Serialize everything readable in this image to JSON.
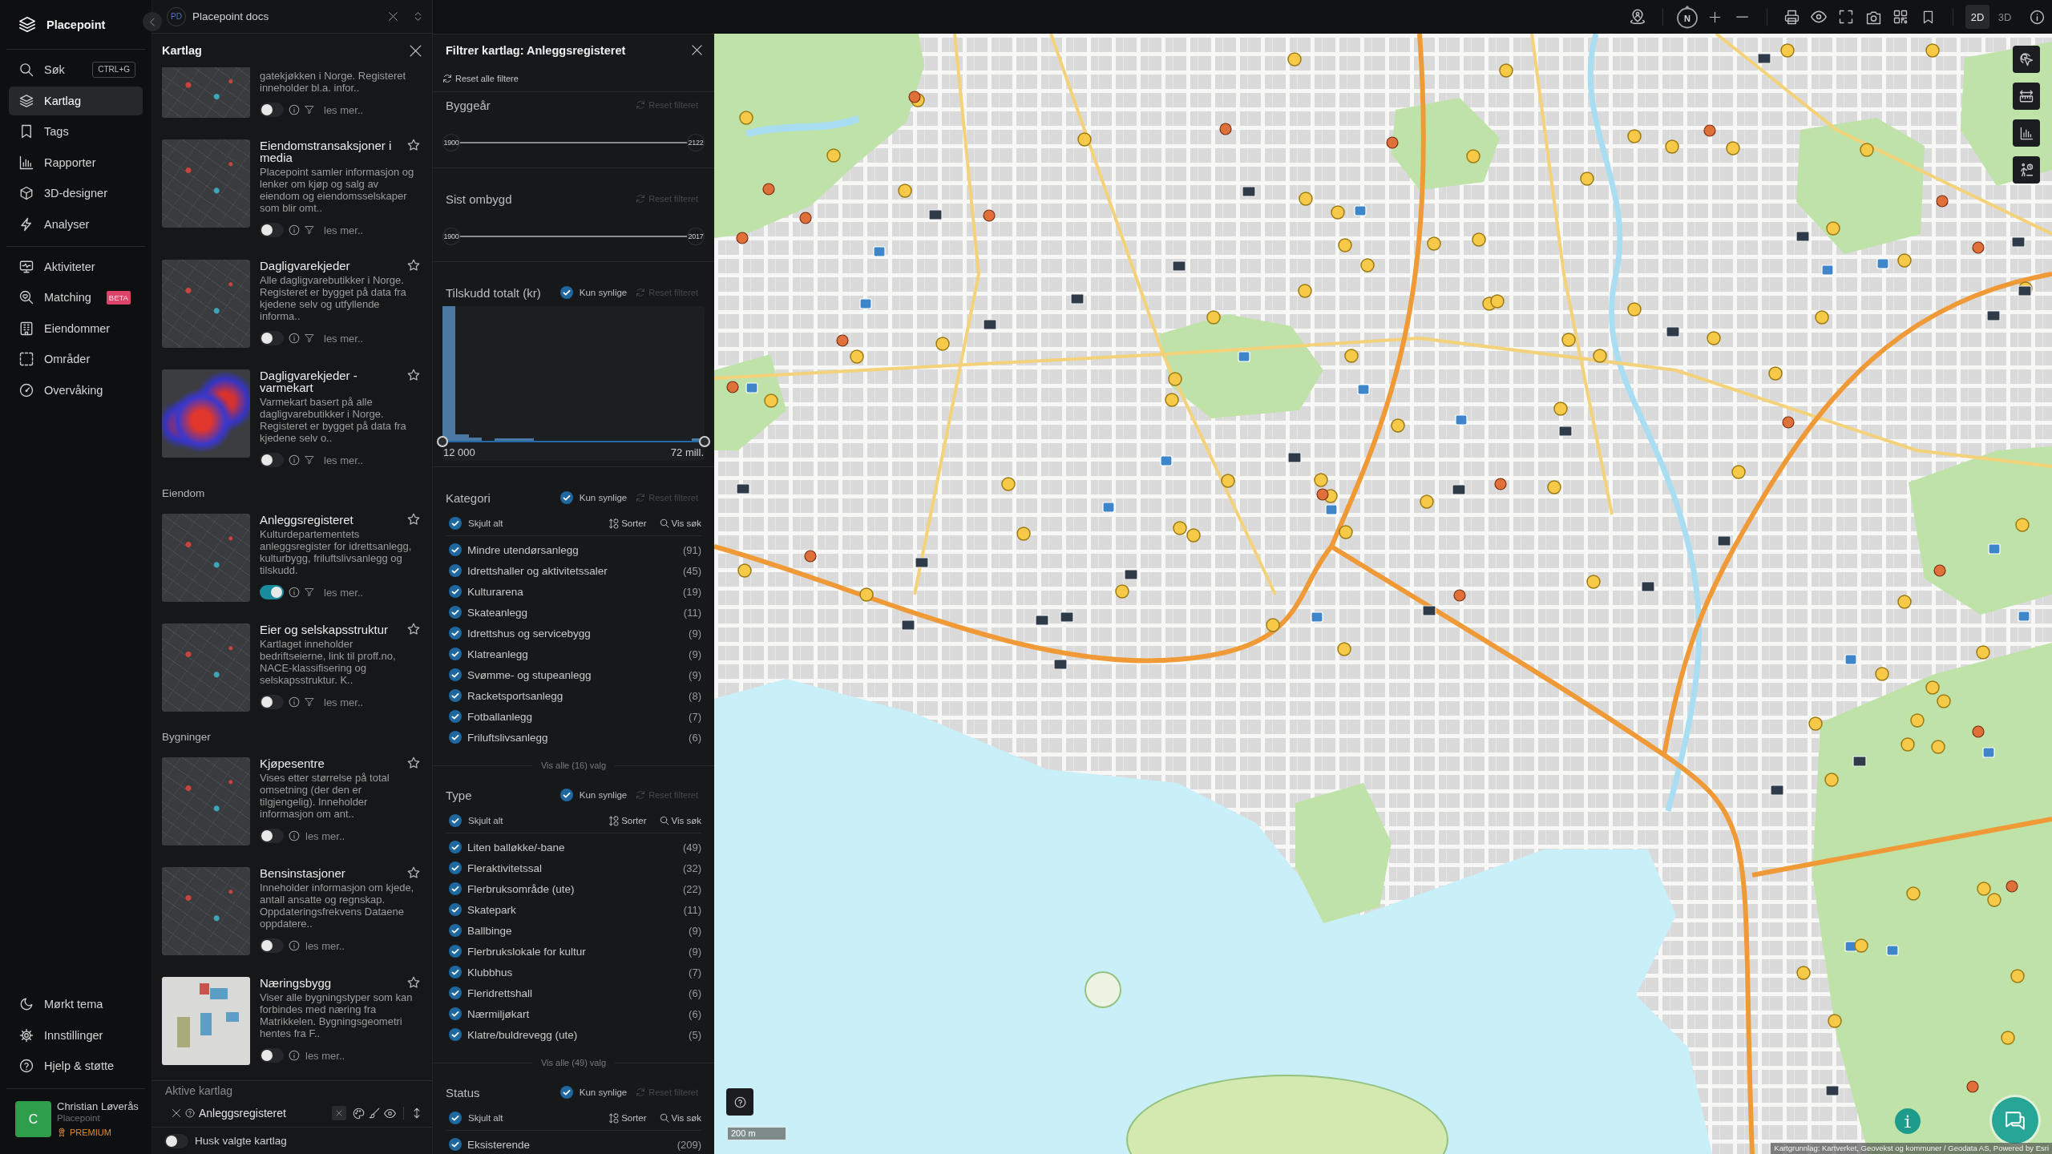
{
  "app": {
    "name": "Placepoint"
  },
  "nav": {
    "main": [
      {
        "label": "Søk",
        "shortcut": "CTRL+G",
        "selected": false
      },
      {
        "label": "Kartlag",
        "selected": true
      },
      {
        "label": "Tags",
        "selected": false
      },
      {
        "label": "Rapporter",
        "selected": false
      },
      {
        "label": "3D-designer",
        "selected": false
      },
      {
        "label": "Analyser",
        "selected": false
      }
    ],
    "secondary": [
      {
        "label": "Aktiviteter",
        "selected": false
      },
      {
        "label": "Matching",
        "badge": "BETA",
        "selected": false
      },
      {
        "label": "Eiendommer",
        "selected": false
      },
      {
        "label": "Områder",
        "selected": false
      },
      {
        "label": "Overvåking",
        "selected": false
      }
    ],
    "footer": [
      {
        "label": "Mørkt tema",
        "selected": false
      },
      {
        "label": "Innstillinger",
        "selected": false
      },
      {
        "label": "Hjelp & støtte",
        "selected": false
      }
    ]
  },
  "user": {
    "initial": "C",
    "name": "Christian Løverås",
    "organization": "Placepoint",
    "plan": "PREMIUM"
  },
  "workspace": {
    "initials": "PD",
    "name": "Placepoint docs"
  },
  "layers_panel": {
    "title": "Kartlag",
    "sections": [
      {
        "layers": [
          {
            "description": "gatekjøkken i Norge. Registeret inneholder bl.a. infor..",
            "thumbnail": {
              "kind": "dark"
            },
            "enabled": false,
            "filterable": true,
            "more": "les mer.."
          },
          {
            "title": "Eiendomstransaksjoner i media",
            "description": "Placepoint samler informasjon og lenker om kjøp og salg av eiendom og eiendomsselskaper som blir omt..",
            "thumbnail": {
              "kind": "dark"
            },
            "favorite": false,
            "enabled": false,
            "filterable": true,
            "more": "les mer.."
          },
          {
            "title": "Dagligvarekjeder",
            "description": "Alle dagligvarebutikker i Norge. Registeret er bygget på data fra kjedene selv og utfyllende informa..",
            "thumbnail": {
              "kind": "dark"
            },
            "favorite": false,
            "enabled": false,
            "filterable": true,
            "more": "les mer.."
          },
          {
            "title": "Dagligvarekjeder - varmekart",
            "description": "Varmekart basert på alle dagligvarebutikker i Norge. Registeret er bygget på data fra kjedene selv o..",
            "thumbnail": {
              "kind": "heat"
            },
            "favorite": false,
            "enabled": false,
            "filterable": true,
            "more": "les mer.."
          }
        ]
      },
      {
        "heading": "Eiendom",
        "layers": [
          {
            "title": "Anleggsregisteret",
            "description": "Kulturdepartementets anleggsregister for idrettsanlegg, kulturbygg, friluftslivsanlegg og tilskudd.",
            "thumbnail": {
              "kind": "dark"
            },
            "favorite": false,
            "enabled": true,
            "filterable": true,
            "more": "les mer.."
          },
          {
            "title": "Eier og selskapsstruktur",
            "description": "Kartlaget inneholder bedriftseierne, link til proff.no, NACE-klassifisering og selskapsstruktur. K..",
            "thumbnail": {
              "kind": "dark"
            },
            "favorite": false,
            "enabled": false,
            "filterable": true,
            "more": "les mer.."
          }
        ]
      },
      {
        "heading": "Bygninger",
        "layers": [
          {
            "title": "Kjøpesentre",
            "description": "Vises etter størrelse på total omsetning (der den er tilgjengelig). Inneholder informasjon om ant..",
            "thumbnail": {
              "kind": "dark"
            },
            "favorite": false,
            "enabled": false,
            "filterable": false,
            "more": "les mer.."
          },
          {
            "title": "Bensinstasjoner",
            "description": "Inneholder informasjon om kjede, antall ansatte og regnskap. Oppdateringsfrekvens Dataene oppdatere..",
            "thumbnail": {
              "kind": "dark"
            },
            "favorite": false,
            "enabled": false,
            "filterable": false,
            "more": "les mer.."
          },
          {
            "title": "Næringsbygg",
            "description": "Viser alle bygningstyper som kan forbindes med næring fra Matrikkelen. Bygningsgeometri hentes fra F..",
            "thumbnail": {
              "kind": "light"
            },
            "favorite": false,
            "enabled": false,
            "filterable": false,
            "more": "les mer.."
          }
        ]
      }
    ],
    "active": {
      "title": "Aktive kartlag",
      "layers": [
        {
          "name": "Anleggsregisteret"
        }
      ]
    },
    "remember": {
      "label": "Husk valgte kartlag",
      "on": false
    }
  },
  "filter_panel": {
    "title": "Filtrer kartlag: Anleggsregisteret",
    "reset_all": "Reset alle filtere",
    "sections": [
      {
        "kind": "range",
        "title": "Byggeår",
        "reset": {
          "label": "Reset filteret",
          "disabled": true
        },
        "thumbs": [
          {
            "label": "1900",
            "level": 0
          },
          {
            "label": "2122",
            "level": 1
          }
        ]
      },
      {
        "kind": "range",
        "title": "Sist ombygd",
        "reset": {
          "label": "Reset filteret",
          "disabled": true
        },
        "thumbs": [
          {
            "label": "1900",
            "level": 0
          },
          {
            "label": "2017",
            "level": 1
          }
        ]
      },
      {
        "kind": "histogram",
        "title": "Tilskudd totalt (kr)",
        "visible_only": {
          "label": "Kun synlige",
          "checked": true
        },
        "reset": {
          "label": "Reset filteret",
          "disabled": true
        },
        "thumbs": [
          {
            "label": "12 000",
            "level": 0
          },
          {
            "label": "72 mill.",
            "level": 1
          }
        ]
      },
      {
        "kind": "checklist",
        "title": "Kategori",
        "visible_only": {
          "label": "Kun synlige",
          "checked": true
        },
        "reset": {
          "label": "Reset filteret",
          "disabled": true
        },
        "select_all": {
          "label": "Skjult alt",
          "checked": true
        },
        "sort": "Sorter",
        "search": "Vis søk",
        "options": [
          {
            "label": "Mindre utendørsanlegg",
            "count": "(91)",
            "checked": true
          },
          {
            "label": "Idrettshaller og aktivitetssaler",
            "count": "(45)",
            "checked": true
          },
          {
            "label": "Kulturarena",
            "count": "(19)",
            "checked": true
          },
          {
            "label": "Skateanlegg",
            "count": "(11)",
            "checked": true
          },
          {
            "label": "Idrettshus og servicebygg",
            "count": "(9)",
            "checked": true
          },
          {
            "label": "Klatreanlegg",
            "count": "(9)",
            "checked": true
          },
          {
            "label": "Svømme- og stupeanlegg",
            "count": "(9)",
            "checked": true
          },
          {
            "label": "Racketsportsanlegg",
            "count": "(8)",
            "checked": true
          },
          {
            "label": "Fotballanlegg",
            "count": "(7)",
            "checked": true
          },
          {
            "label": "Friluftslivsanlegg",
            "count": "(6)",
            "checked": true
          }
        ],
        "show_all": "Vis alle (16) valg"
      },
      {
        "kind": "checklist",
        "title": "Type",
        "visible_only": {
          "label": "Kun synlige",
          "checked": true
        },
        "reset": {
          "label": "Reset filteret",
          "disabled": true
        },
        "select_all": {
          "label": "Skjult alt",
          "checked": true
        },
        "sort": "Sorter",
        "search": "Vis søk",
        "options": [
          {
            "label": "Liten balløkke/-bane",
            "count": "(49)",
            "checked": true
          },
          {
            "label": "Fleraktivitetssal",
            "count": "(32)",
            "checked": true
          },
          {
            "label": "Flerbruksområde (ute)",
            "count": "(22)",
            "checked": true
          },
          {
            "label": "Skatepark",
            "count": "(11)",
            "checked": true
          },
          {
            "label": "Ballbinge",
            "count": "(9)",
            "checked": true
          },
          {
            "label": "Flerbrukslokale for kultur",
            "count": "(9)",
            "checked": true
          },
          {
            "label": "Klubbhus",
            "count": "(7)",
            "checked": true
          },
          {
            "label": "Fleridrettshall",
            "count": "(6)",
            "checked": true
          },
          {
            "label": "Nærmiljøkart",
            "count": "(6)",
            "checked": true
          },
          {
            "label": "Klatre/buldrevegg (ute)",
            "count": "(5)",
            "checked": true
          }
        ],
        "show_all": "Vis alle (49) valg"
      },
      {
        "kind": "checklist",
        "title": "Status",
        "visible_only": {
          "label": "Kun synlige",
          "checked": true
        },
        "reset": {
          "label": "Reset filteret",
          "disabled": true
        },
        "select_all": {
          "label": "Skjult alt",
          "checked": true
        },
        "sort": "Sorter",
        "search": "Vis søk",
        "options": [
          {
            "label": "Eksisterende",
            "count": "(209)",
            "checked": true
          }
        ]
      }
    ]
  },
  "map_toolbar": {
    "compass": "N",
    "view_modes": [
      {
        "label": "2D",
        "selected": true
      },
      {
        "label": "3D",
        "selected": false
      }
    ]
  },
  "map": {
    "scale": "200 m",
    "attribution": "Kartgrunnlag: Kartverket, Geovekst og kommuner / Geodata AS, Powered by Esri"
  }
}
